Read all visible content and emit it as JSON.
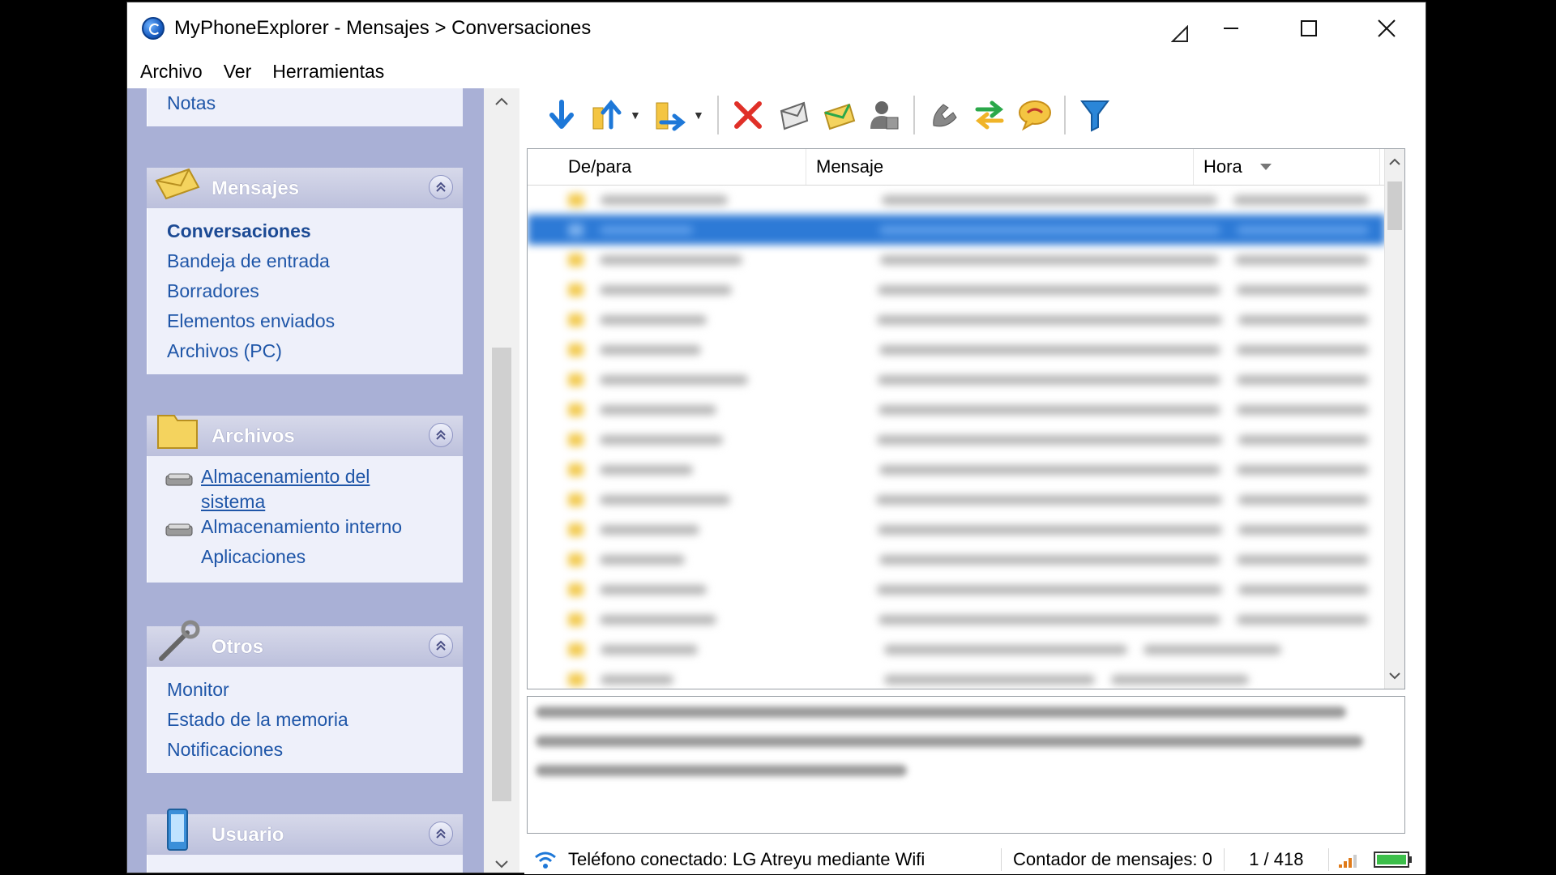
{
  "window": {
    "title": "MyPhoneExplorer -  Mensajes > Conversaciones"
  },
  "menu": [
    "Archivo",
    "Ver",
    "Herramientas"
  ],
  "sidebar": {
    "top_link": "Notas",
    "mensajes": {
      "title": "Mensajes",
      "items": [
        "Conversaciones",
        "Bandeja de entrada",
        "Borradores",
        "Elementos enviados",
        "Archivos (PC)"
      ]
    },
    "archivos": {
      "title": "Archivos",
      "items": [
        "Almacenamiento del sistema",
        "Almacenamiento interno",
        "Aplicaciones"
      ]
    },
    "otros": {
      "title": "Otros",
      "items": [
        "Monitor",
        "Estado de la memoria",
        "Notificaciones"
      ]
    },
    "usuario": {
      "title": "Usuario"
    }
  },
  "toolbar": {
    "buttons": [
      "download-icon",
      "upload-icon",
      "move-icon",
      "delete-icon",
      "reply-icon",
      "forward-icon",
      "contact-icon",
      "call-icon",
      "sync-icon",
      "chat-icon",
      "filter-icon"
    ]
  },
  "list": {
    "columns": [
      "De/para",
      "Mensaje",
      "Hora"
    ],
    "rows_blurred": 17,
    "selected_index": 1
  },
  "status": {
    "connection": "Teléfono conectado: LG Atreyu mediante Wifi",
    "counter": "Contador de mensajes: 0",
    "position": "1 / 418"
  },
  "colors": {
    "sidebar_bg": "#a9b0d6",
    "link": "#1f56a8",
    "selection": "#2d7ad6"
  }
}
